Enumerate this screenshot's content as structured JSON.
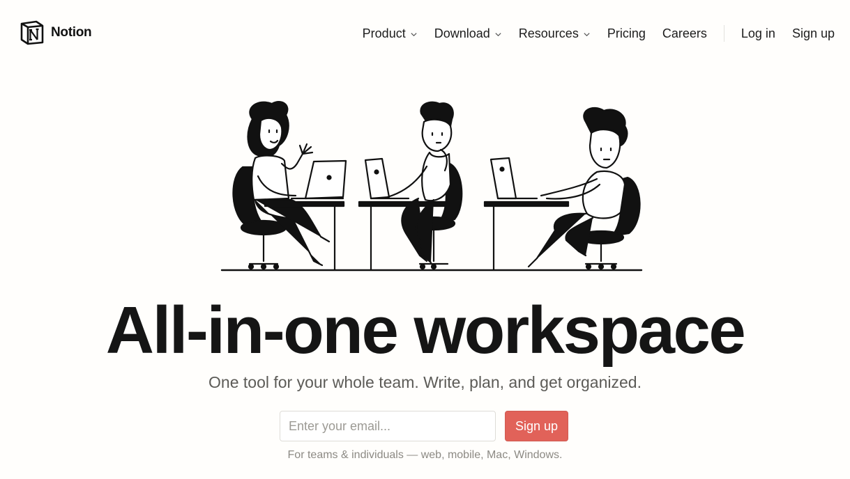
{
  "brand": {
    "name": "Notion"
  },
  "nav": {
    "items": [
      {
        "label": "Product",
        "has_dropdown": true
      },
      {
        "label": "Download",
        "has_dropdown": true
      },
      {
        "label": "Resources",
        "has_dropdown": true
      },
      {
        "label": "Pricing",
        "has_dropdown": false
      },
      {
        "label": "Careers",
        "has_dropdown": false
      }
    ],
    "login": "Log in",
    "signup": "Sign up"
  },
  "hero": {
    "illustration": "three-people-at-laptops-illustration",
    "headline": "All-in-one workspace",
    "subheadline": "One tool for your whole team. Write, plan, and get organized.",
    "email_placeholder": "Enter your email...",
    "email_value": "",
    "cta_label": "Sign up",
    "footnote": "For teams & individuals — web, mobile, Mac, Windows."
  },
  "colors": {
    "background": "#fffefc",
    "cta": "#e16259",
    "text": "#151515",
    "muted": "#5c5b57"
  }
}
